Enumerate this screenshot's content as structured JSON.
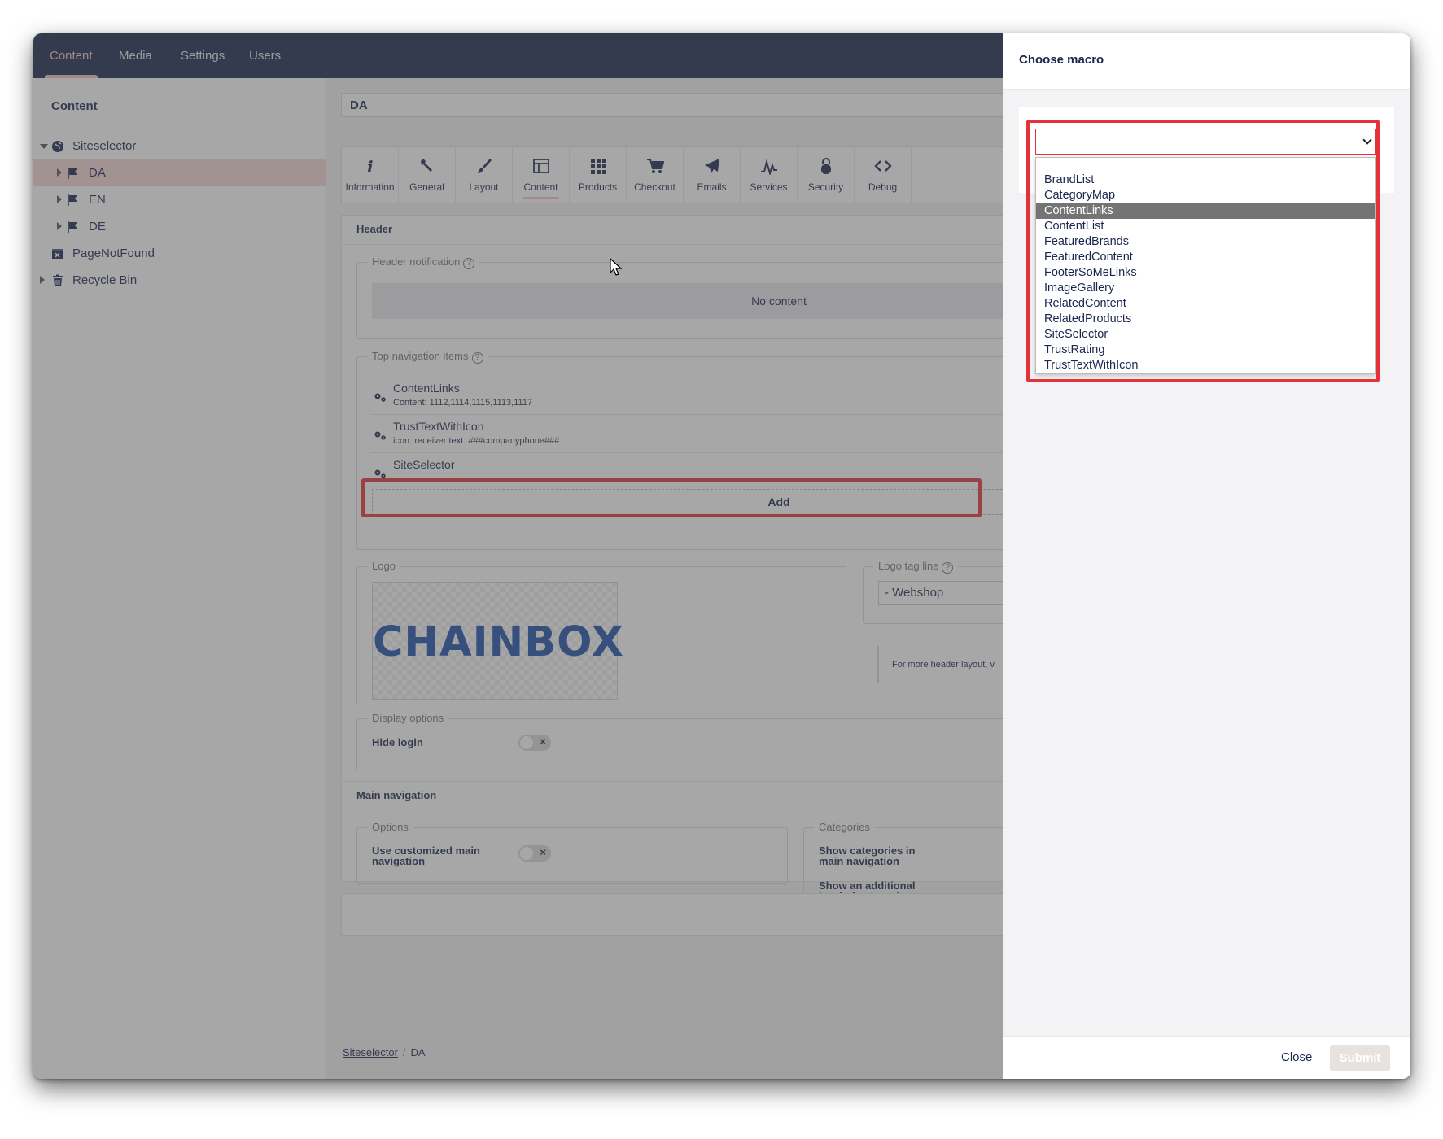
{
  "topnav": {
    "items": [
      "Content",
      "Media",
      "Settings",
      "Users"
    ],
    "active": "Content"
  },
  "tree": {
    "title": "Content",
    "root": "Siteselector",
    "children": [
      "DA",
      "EN",
      "DE"
    ],
    "others": [
      "PageNotFound",
      "Recycle Bin"
    ],
    "selected": "DA"
  },
  "editor": {
    "node_name": "DA",
    "tabs": [
      "Information",
      "General",
      "Layout",
      "Content",
      "Products",
      "Checkout",
      "Emails",
      "Services",
      "Security",
      "Debug"
    ],
    "active_tab": "Content",
    "header_group": "Header",
    "header_notification": {
      "legend": "Header notification",
      "empty": "No content"
    },
    "top_nav": {
      "legend": "Top navigation items",
      "macros": [
        {
          "name": "ContentLinks",
          "param_key": "Content:",
          "param_value": "1112,1114,1115,1113,1117"
        },
        {
          "name": "TrustTextWithIcon",
          "param_key": "icon:",
          "param_value": "receiver",
          "param_key2": "text:",
          "param_value2": "###companyphone###"
        },
        {
          "name": "SiteSelector"
        }
      ],
      "add_label": "Add"
    },
    "logo": {
      "legend": "Logo",
      "image_text": "CHAINBOX"
    },
    "logo_tag_line": {
      "legend": "Logo tag line",
      "value": "- Webshop"
    },
    "header_layout_note": "For more header layout, v",
    "display_options": {
      "legend": "Display options",
      "hide_login": "Hide login"
    },
    "main_nav_group": "Main navigation",
    "options": {
      "legend": "Options",
      "use_custom": "Use customized main navigation"
    },
    "categories": {
      "legend": "Categories",
      "show_cats": "Show categories in main navigation",
      "show_level": "Show an additional level of categories"
    },
    "breadcrumb": {
      "root": "Siteselector",
      "current": "DA"
    }
  },
  "dialog": {
    "title": "Choose macro",
    "select_value": "",
    "options": [
      "BrandList",
      "CategoryMap",
      "ContentLinks",
      "ContentList",
      "FeaturedBrands",
      "FeaturedContent",
      "FooterSoMeLinks",
      "ImageGallery",
      "RelatedContent",
      "RelatedProducts",
      "SiteSelector",
      "TrustRating",
      "TrustTextWithIcon"
    ],
    "highlighted_option": "ContentLinks",
    "close_label": "Close",
    "submit_label": "Submit"
  },
  "colors": {
    "topbar": "#1b264f",
    "accent": "#f5c1bc",
    "highlight": "#e53238",
    "logo": "#1e4fa8"
  }
}
